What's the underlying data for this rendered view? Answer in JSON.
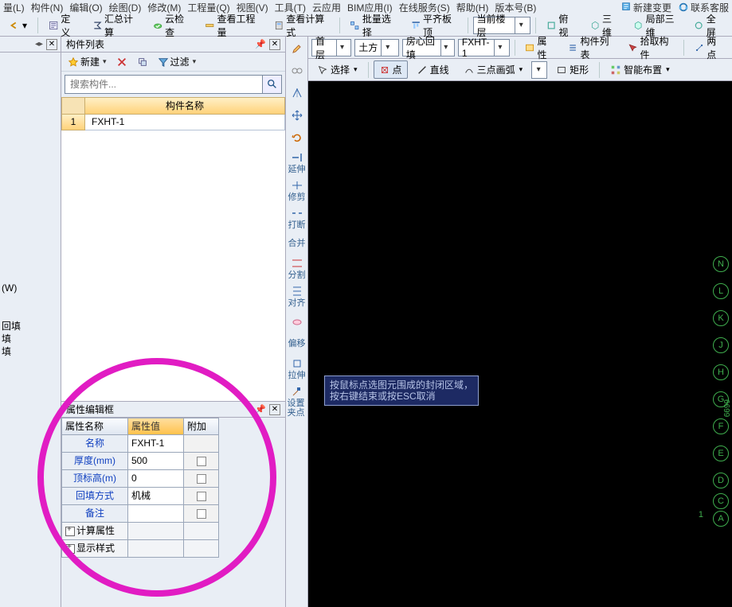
{
  "menubar": {
    "items": [
      "量(L)",
      "构件(N)",
      "编辑(O)",
      "绘图(D)",
      "修改(M)",
      "工程量(Q)",
      "视图(V)",
      "工具(T)",
      "云应用",
      "BIM应用(I)",
      "在线服务(S)",
      "帮助(H)",
      "版本号(B)"
    ],
    "right": [
      {
        "icon": "bell-icon",
        "label": "新建变更"
      },
      {
        "icon": "headset-icon",
        "label": "联系客服"
      }
    ]
  },
  "toolbar": {
    "left_arrow": "↩",
    "items": [
      {
        "icon": "define-icon",
        "label": "定义"
      },
      {
        "icon": "sigma-icon",
        "label": "汇总计算"
      },
      {
        "icon": "cloud-icon",
        "label": "云检查"
      },
      {
        "icon": "ruler-icon",
        "label": "查看工程量"
      },
      {
        "icon": "calc-icon",
        "label": "查看计算式"
      },
      {
        "icon": "batch-icon",
        "label": "批量选择"
      },
      {
        "icon": "align-icon",
        "label": "平齐板顶"
      }
    ],
    "floor": "当前楼层",
    "view_items": [
      {
        "icon": "topview-icon",
        "label": "俯视"
      },
      {
        "icon": "iso-icon",
        "label": "三维"
      },
      {
        "icon": "local3d-icon",
        "label": "局部三维"
      },
      {
        "icon": "fullscreen-icon",
        "label": "全屏"
      }
    ]
  },
  "component_panel": {
    "title": "构件列表",
    "new": "新建",
    "filter": "过滤",
    "search_placeholder": "搜索构件...",
    "col_header": "构件名称",
    "rows": [
      {
        "n": "1",
        "name": "FXHT-1"
      }
    ]
  },
  "left_tree": {
    "items": [
      "(W)",
      "",
      "回填",
      "填",
      "填"
    ]
  },
  "prop_panel": {
    "title": "属性编辑框",
    "cols": [
      "属性名称",
      "属性值",
      "附加"
    ],
    "rows": [
      {
        "k": "名称",
        "v": "FXHT-1",
        "chk": false
      },
      {
        "k": "厚度(mm)",
        "v": "500",
        "chk": true
      },
      {
        "k": "顶标高(m)",
        "v": "0",
        "chk": true
      },
      {
        "k": "回填方式",
        "v": "机械",
        "chk": true
      },
      {
        "k": "备注",
        "v": "",
        "chk": true
      }
    ],
    "groups": [
      "计算属性",
      "显示样式"
    ]
  },
  "vtools": [
    {
      "icon": "brush-icon",
      "label": ""
    },
    {
      "icon": "link-icon",
      "label": ""
    },
    {
      "icon": "mirror2-icon",
      "label": ""
    },
    {
      "icon": "move-icon",
      "label": ""
    },
    {
      "icon": "rotate-icon",
      "label": ""
    },
    {
      "icon": "extend-icon",
      "label": "延伸"
    },
    {
      "icon": "trim-icon",
      "label": "修剪"
    },
    {
      "icon": "break-icon",
      "label": "打断"
    },
    {
      "icon": "merge-icon",
      "label": "合并"
    },
    {
      "icon": "split-icon",
      "label": "分割"
    },
    {
      "icon": "align2-icon",
      "label": "对齐"
    },
    {
      "icon": "cloud2-icon",
      "label": ""
    },
    {
      "icon": "offset-icon",
      "label": "偏移"
    },
    {
      "icon": "stretch-icon",
      "label": "拉伸"
    },
    {
      "icon": "grip-icon",
      "label": "设置夹点"
    }
  ],
  "canvas": {
    "combos": [
      "首层",
      "土方",
      "房心回填",
      "FXHT-1"
    ],
    "row1_btns": [
      {
        "icon": "props-icon",
        "label": "属性"
      },
      {
        "icon": "list-icon",
        "label": "构件列表"
      },
      {
        "icon": "pick-icon",
        "label": "拾取构件"
      },
      {
        "icon": "twopoint-icon",
        "label": "两点"
      }
    ],
    "row2": [
      {
        "icon": "select-icon",
        "label": "选择",
        "dd": true
      },
      {
        "icon": "point-icon",
        "label": "点",
        "boxed": true
      },
      {
        "icon": "line-icon",
        "label": "直线"
      },
      {
        "icon": "arc3-icon",
        "label": "三点画弧",
        "dd": true
      },
      {
        "icon": "rect-icon",
        "label": "矩形"
      },
      {
        "icon": "smart-icon",
        "label": "智能布置",
        "dd": true
      }
    ],
    "tooltip": [
      "按鼠标点选图元围成的封闭区域，",
      "按右键结束或按ESC取消"
    ],
    "axes": [
      "N",
      "L",
      "K",
      "J",
      "H",
      "G",
      "F",
      "E",
      "D",
      "C",
      "A"
    ],
    "axis_num": "6699",
    "axis_one": "1"
  }
}
